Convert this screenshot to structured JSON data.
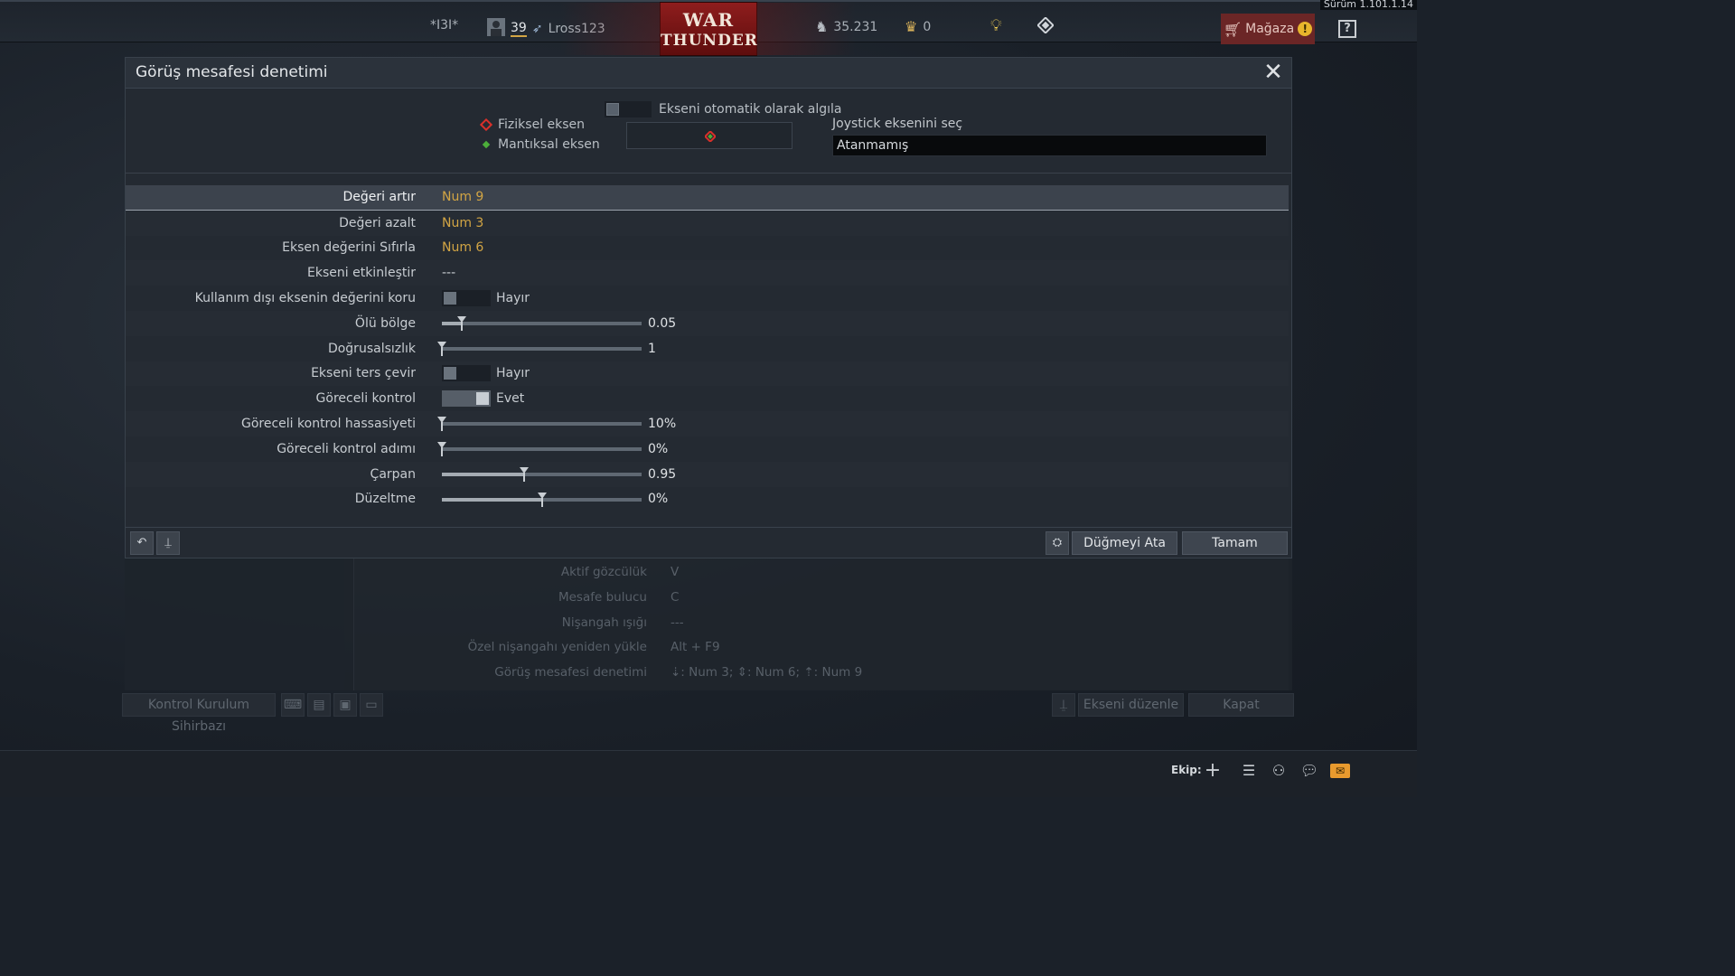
{
  "version": "Sürüm 1.101.1.14",
  "topbar": {
    "squad_tag": "*I3I*",
    "level": "39",
    "username": "Lross123",
    "logo_line1": "WAR",
    "logo_line2": "THUNDER",
    "silver_lions": "35.231",
    "golden_eagles": "0",
    "store_label": "Mağaza",
    "store_alert": "!",
    "help_label": "?"
  },
  "dialog": {
    "title": "Görüş mesafesi denetimi",
    "close_label": "✕",
    "physical_axis": "Fiziksel eksen",
    "logical_axis": "Mantıksal eksen",
    "auto_detect": "Ekseni otomatik olarak algıla",
    "joystick_label": "Joystick eksenini seç",
    "joystick_value": "Atanmamış",
    "rows": [
      {
        "label": "Değeri artır",
        "value": "Num 9"
      },
      {
        "label": "Değeri azalt",
        "value": "Num 3"
      },
      {
        "label": "Eksen değerini Sıfırla",
        "value": "Num 6"
      },
      {
        "label": "Ekseni etkinleştir",
        "value": "---"
      },
      {
        "label": "Kullanım dışı eksenin değerini koru",
        "value": "Hayır"
      },
      {
        "label": "Ölü bölge",
        "value": "0.05",
        "fraction": 0.1
      },
      {
        "label": "Doğrusalsızlık",
        "value": "1",
        "fraction": 0.0
      },
      {
        "label": "Ekseni ters çevir",
        "value": "Hayır"
      },
      {
        "label": "Göreceli kontrol",
        "value": "Evet"
      },
      {
        "label": "Göreceli kontrol hassasiyeti",
        "value": "10%",
        "fraction": 0.0
      },
      {
        "label": "Göreceli kontrol adımı",
        "value": "0%",
        "fraction": 0.0
      },
      {
        "label": "Çarpan",
        "value": "0.95",
        "fraction": 0.41
      },
      {
        "label": "Düzeltme",
        "value": "0%",
        "fraction": 0.5
      }
    ],
    "assign_button": "Düğmeyi Ata",
    "ok_button": "Tamam"
  },
  "background": {
    "rows": [
      {
        "label": "Aktif gözcülük",
        "value": "V"
      },
      {
        "label": "Mesafe bulucu",
        "value": "C"
      },
      {
        "label": "Nişangah ışığı",
        "value": "---"
      },
      {
        "label": "Özel nişangahı yeniden yükle",
        "value": "Alt + F9"
      },
      {
        "label": "Görüş mesafesi denetimi",
        "value": "⇣: Num 3;  ⇕: Num 6;  ⇡: Num 9"
      }
    ],
    "wizard_button": "Kontrol Kurulum Sihirbazı",
    "edit_axis_button": "Ekseni düzenle",
    "close_button": "Kapat"
  },
  "bottombar": {
    "squad_label": "Ekip:"
  }
}
